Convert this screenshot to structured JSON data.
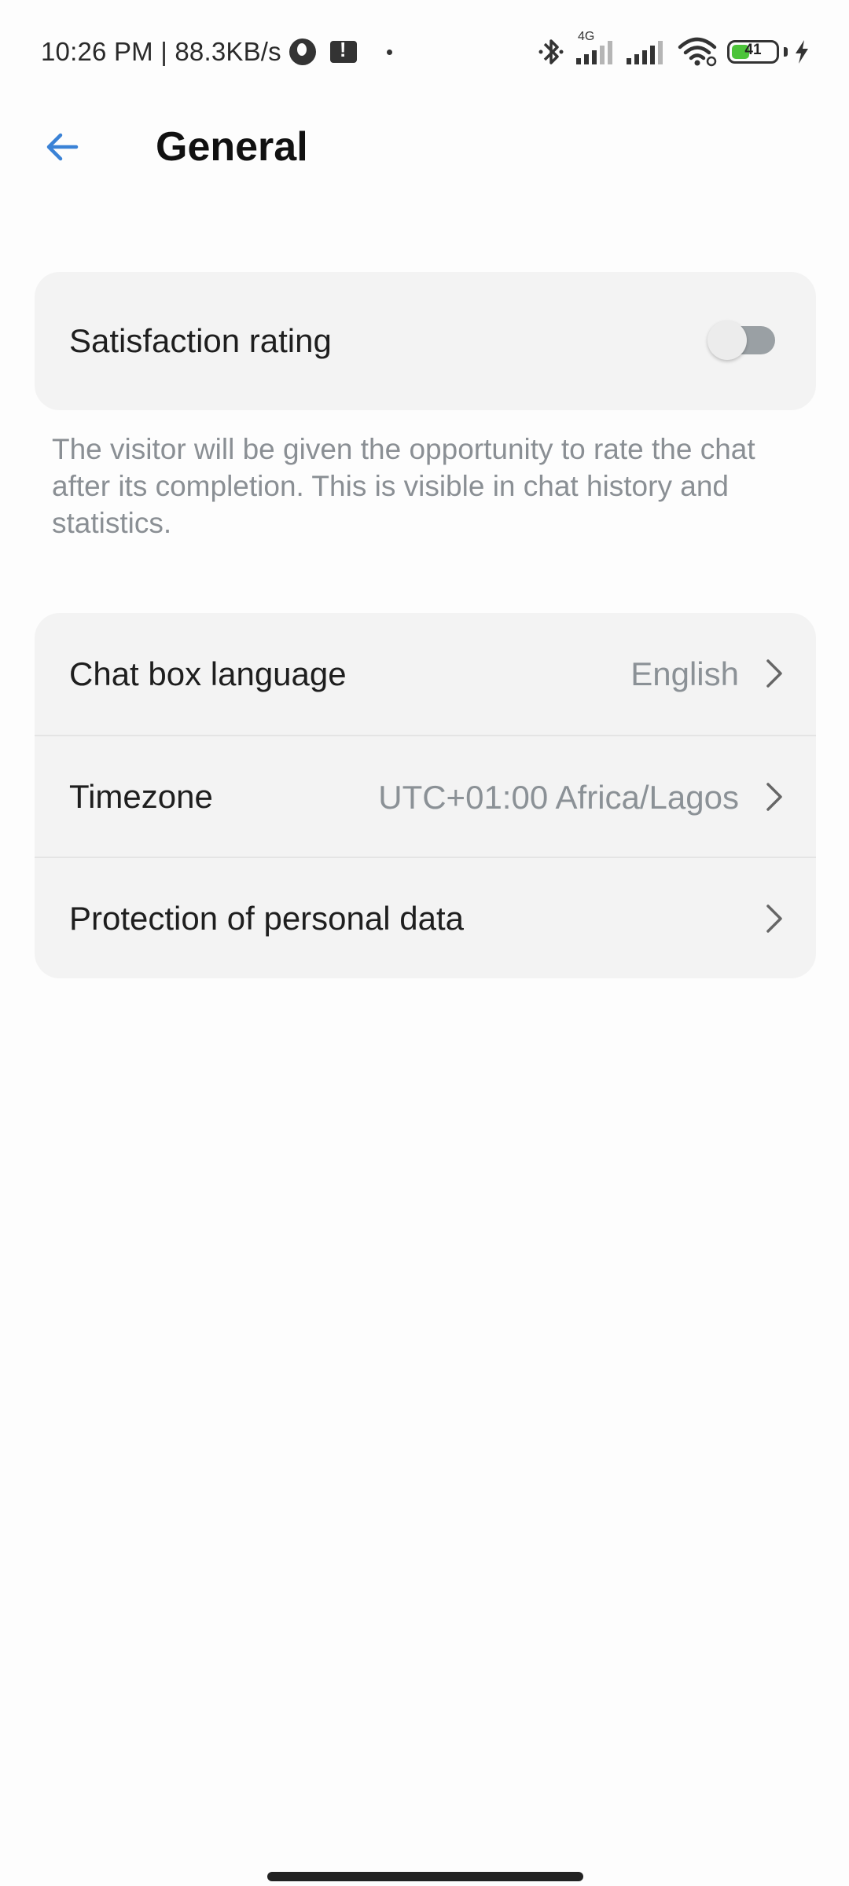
{
  "status_bar": {
    "time_speed": "10:26 PM | 88.3KB/s",
    "network_type": "4G",
    "battery_level": "41",
    "battery_fraction": 0.41,
    "icons": [
      "app-icon",
      "sd-card-alert-icon",
      "dot-icon",
      "bluetooth-icon",
      "signal-icon",
      "wifi-icon",
      "battery-icon",
      "charging-icon"
    ]
  },
  "header": {
    "title": "General",
    "back_icon": "arrow-left-icon",
    "accent_color": "#3a82d6"
  },
  "satisfaction": {
    "label": "Satisfaction rating",
    "enabled": false,
    "description": "The visitor will be given the opportunity to rate the chat after its completion. This is visible in chat history and statistics."
  },
  "settings": {
    "chat_box_language": {
      "label": "Chat box language",
      "value": "English"
    },
    "timezone": {
      "label": "Timezone",
      "value": "UTC+01:00 Africa/Lagos"
    },
    "personal_data": {
      "label": "Protection of personal data"
    }
  }
}
